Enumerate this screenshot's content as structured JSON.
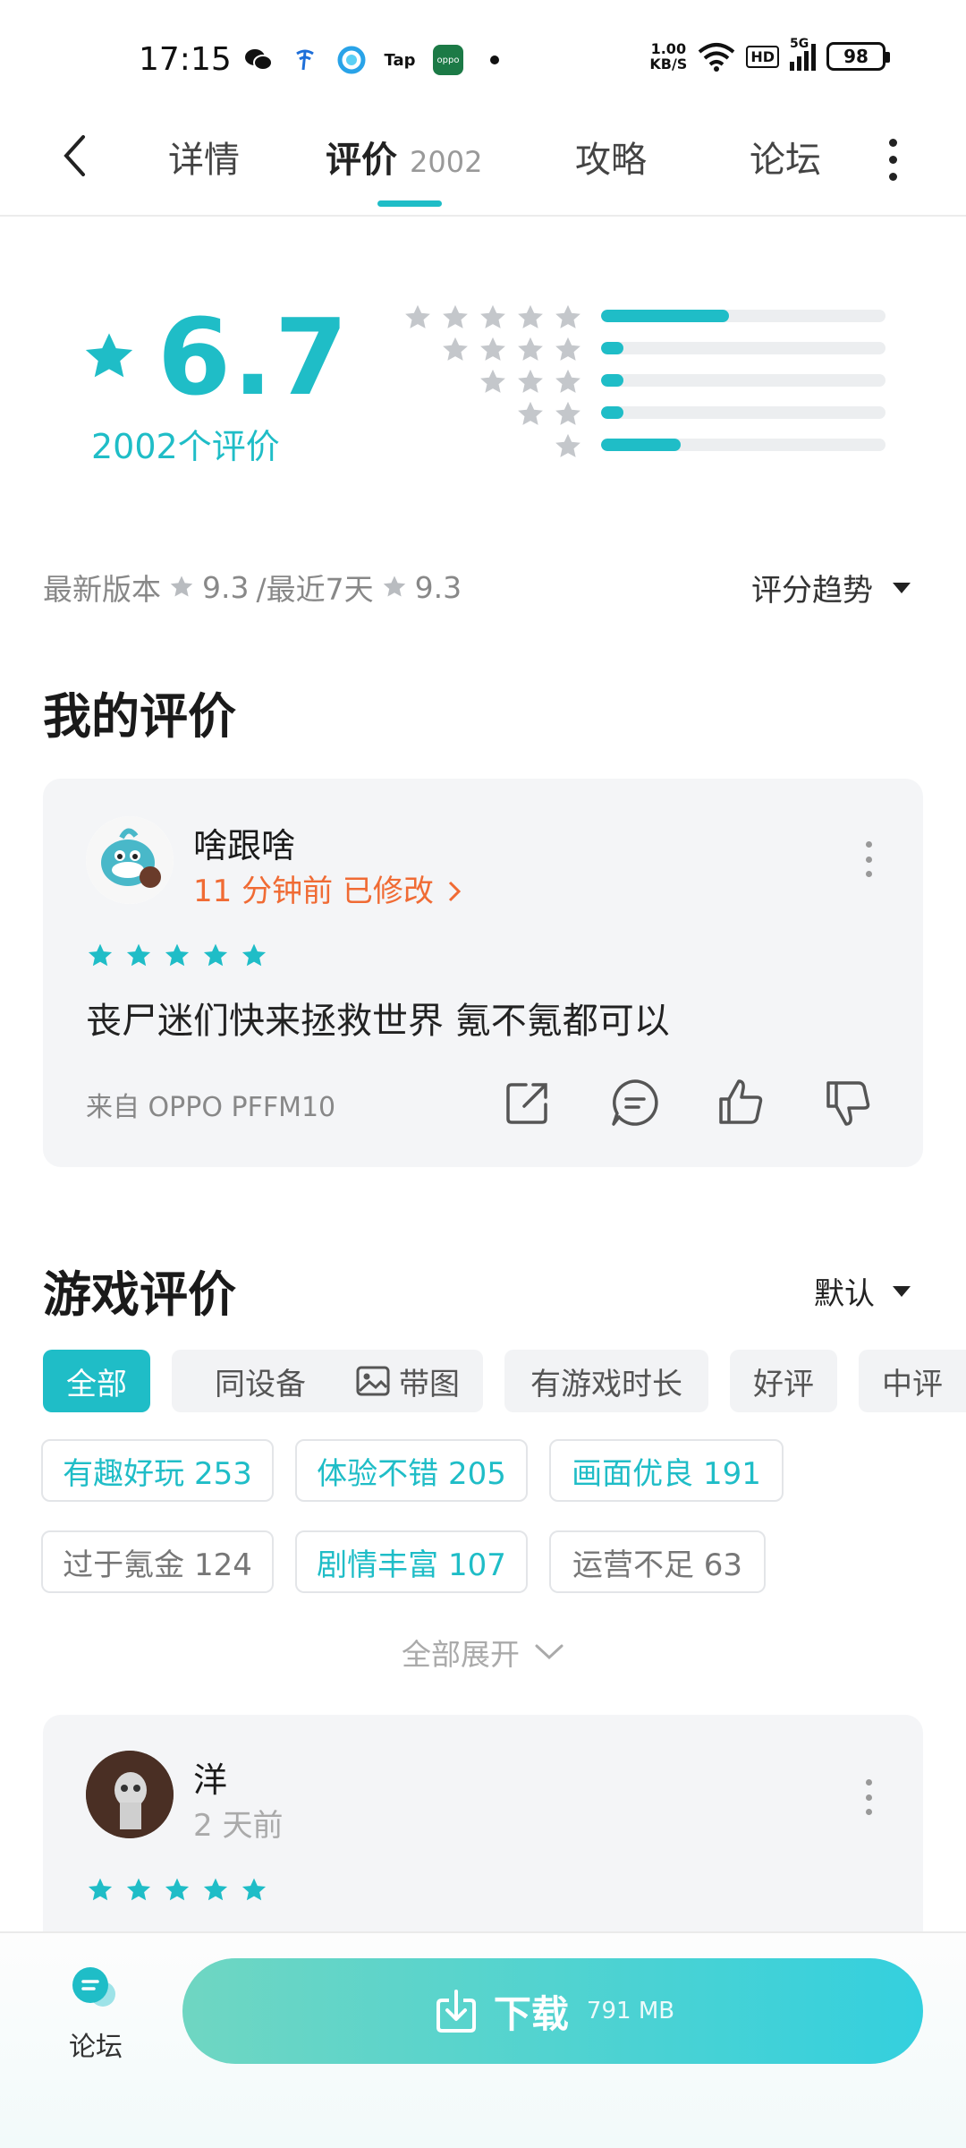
{
  "status": {
    "time": "17:15",
    "net_speed_top": "1.00",
    "net_speed_unit": "KB/S",
    "hd": "HD",
    "signal": "5G",
    "battery": "98"
  },
  "nav": {
    "tabs": [
      {
        "label": "详情"
      },
      {
        "label": "评价",
        "count": "2002"
      },
      {
        "label": "攻略"
      },
      {
        "label": "论坛"
      }
    ],
    "active_tab": "评价"
  },
  "summary": {
    "score": "6.7",
    "count_text": "2002个评价",
    "histogram": [
      {
        "stars": 5,
        "fraction": 0.45
      },
      {
        "stars": 4,
        "fraction": 0.08
      },
      {
        "stars": 3,
        "fraction": 0.08
      },
      {
        "stars": 2,
        "fraction": 0.08
      },
      {
        "stars": 1,
        "fraction": 0.28
      }
    ],
    "latest_label": "最新版本",
    "latest_score": "9.3",
    "recent_label": "/最近7天",
    "recent_score": "9.3",
    "trend_label": "评分趋势"
  },
  "my_review": {
    "heading": "我的评价",
    "user": "啥跟啥",
    "time": "11 分钟前",
    "edited": "已修改",
    "stars": 5,
    "text": "丧尸迷们快来拯救世界 氪不氪都可以",
    "device": "来自 OPPO PFFM10"
  },
  "game_reviews": {
    "heading": "游戏评价",
    "sort": "默认",
    "filters": [
      "全部",
      "同设备",
      "带图",
      "有游戏时长",
      "好评",
      "中评"
    ],
    "tags": [
      {
        "label": "有趣好玩 253",
        "tone": "teal"
      },
      {
        "label": "体验不错 205",
        "tone": "teal"
      },
      {
        "label": "画面优良 191",
        "tone": "teal"
      },
      {
        "label": "过于氪金 124",
        "tone": "gray"
      },
      {
        "label": "剧情丰富 107",
        "tone": "teal"
      },
      {
        "label": "运营不足 63",
        "tone": "gray"
      }
    ],
    "expand_label": "全部展开",
    "first_review": {
      "user": "洋",
      "time": "2 天前",
      "stars": 5
    }
  },
  "bottom": {
    "forum_label": "论坛",
    "download_label": "下载",
    "download_size": "791 MB"
  },
  "colors": {
    "accent": "#1fbdc7",
    "orange": "#f06b34"
  }
}
